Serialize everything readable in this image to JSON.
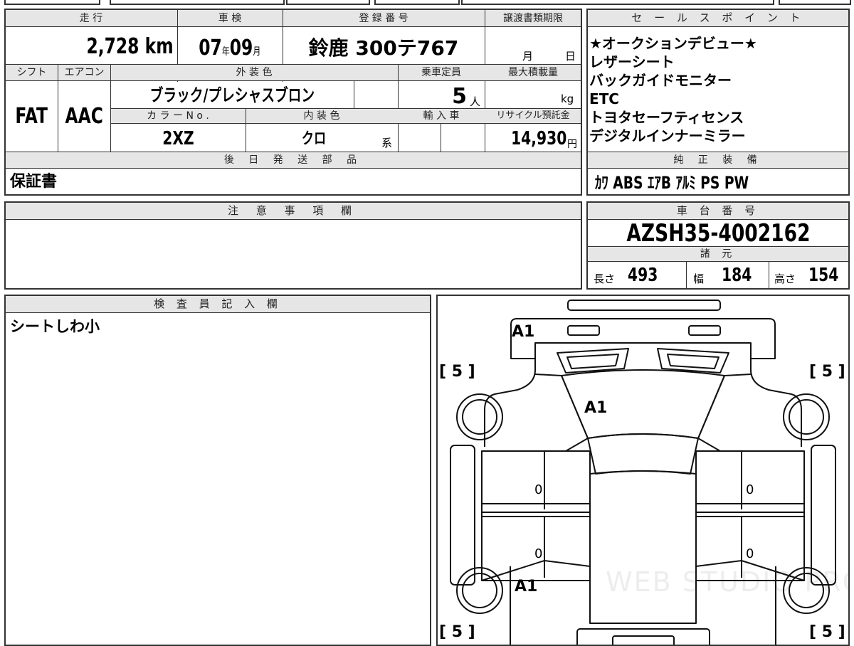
{
  "vehicle": {
    "mileage_label": "走 行",
    "mileage_value": "2,728",
    "mileage_unit": "km",
    "shaken_label": "車 検",
    "shaken_year": "07",
    "shaken_year_unit": "年",
    "shaken_month": "09",
    "shaken_month_unit": "月",
    "reg_label": "登 録 番 号",
    "reg_value": "鈴鹿 300テ767",
    "transfer_label": "譲渡書類期限",
    "transfer_month_unit": "月",
    "transfer_day_unit": "日",
    "shift_label": "シフト",
    "shift_value": "FAT",
    "ac_label": "エアコン",
    "ac_value": "AAC",
    "exterior_label": "外 装 色",
    "exterior_value": "ブラック/プレシャスブロン",
    "capacity_label": "乗車定員",
    "capacity_value": "5",
    "capacity_unit": "人",
    "maxload_label": "最大積載量",
    "maxload_unit": "kg",
    "color_no_label": "カ ラ ー N o .",
    "color_no_value": "2XZ",
    "interior_label": "内 装 色",
    "interior_value": "クロ",
    "interior_unit": "系",
    "import_label": "輸 入 車",
    "recycle_label": "リサイクル預託金",
    "recycle_value": "14,930",
    "recycle_unit": "円"
  },
  "later_parts": {
    "label": "後 日 発 送 部 品",
    "value": "保証書"
  },
  "notes": {
    "label": "注 意 事 項 欄",
    "value": ""
  },
  "inspector": {
    "label": "検 査 員 記 入 欄",
    "value": "シートしわ小"
  },
  "sales_points": {
    "label": "セ ー ル ス ポ イ ン ト",
    "items": [
      "★オークションデビュー★",
      "レザーシート",
      "バックガイドモニター",
      "ETC",
      "トヨタセーフティセンス",
      "デジタルインナーミラー"
    ]
  },
  "equipment": {
    "label": "純 正 装 備",
    "value": "ｶﾜ ABS ｴｱB ｱﾙﾐ PS PW"
  },
  "chassis": {
    "label": "車 台 番 号",
    "value": "AZSH35-4002162"
  },
  "specs": {
    "label": "諸 元",
    "length_label": "長さ",
    "length_value": "493",
    "width_label": "幅",
    "width_value": "184",
    "height_label": "高さ",
    "height_value": "154"
  },
  "diagram": {
    "mark_front": "A1",
    "mark_hood": "A1",
    "mark_rear_left": "A1",
    "tire_fl": "[ 5 ]",
    "tire_fr": "[ 5 ]",
    "tire_rl": "[ 5 ]",
    "tire_rr": "[ 5 ]",
    "door_fl": "0",
    "door_fr": "0",
    "door_rl": "0",
    "door_rr": "0",
    "watermark": "WEB STUDIO PRO"
  }
}
